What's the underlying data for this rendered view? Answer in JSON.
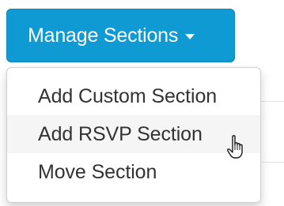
{
  "manage_button": {
    "label": "Manage Sections",
    "icon": "caret-down-icon",
    "color": "#0f9ad4"
  },
  "dropdown": {
    "items": [
      {
        "label": "Add Custom Section"
      },
      {
        "label": "Add RSVP Section"
      },
      {
        "label": "Move Section"
      }
    ],
    "hover_color": "#f5f5f5"
  },
  "cursor": {
    "icon": "hand-pointer-icon"
  }
}
